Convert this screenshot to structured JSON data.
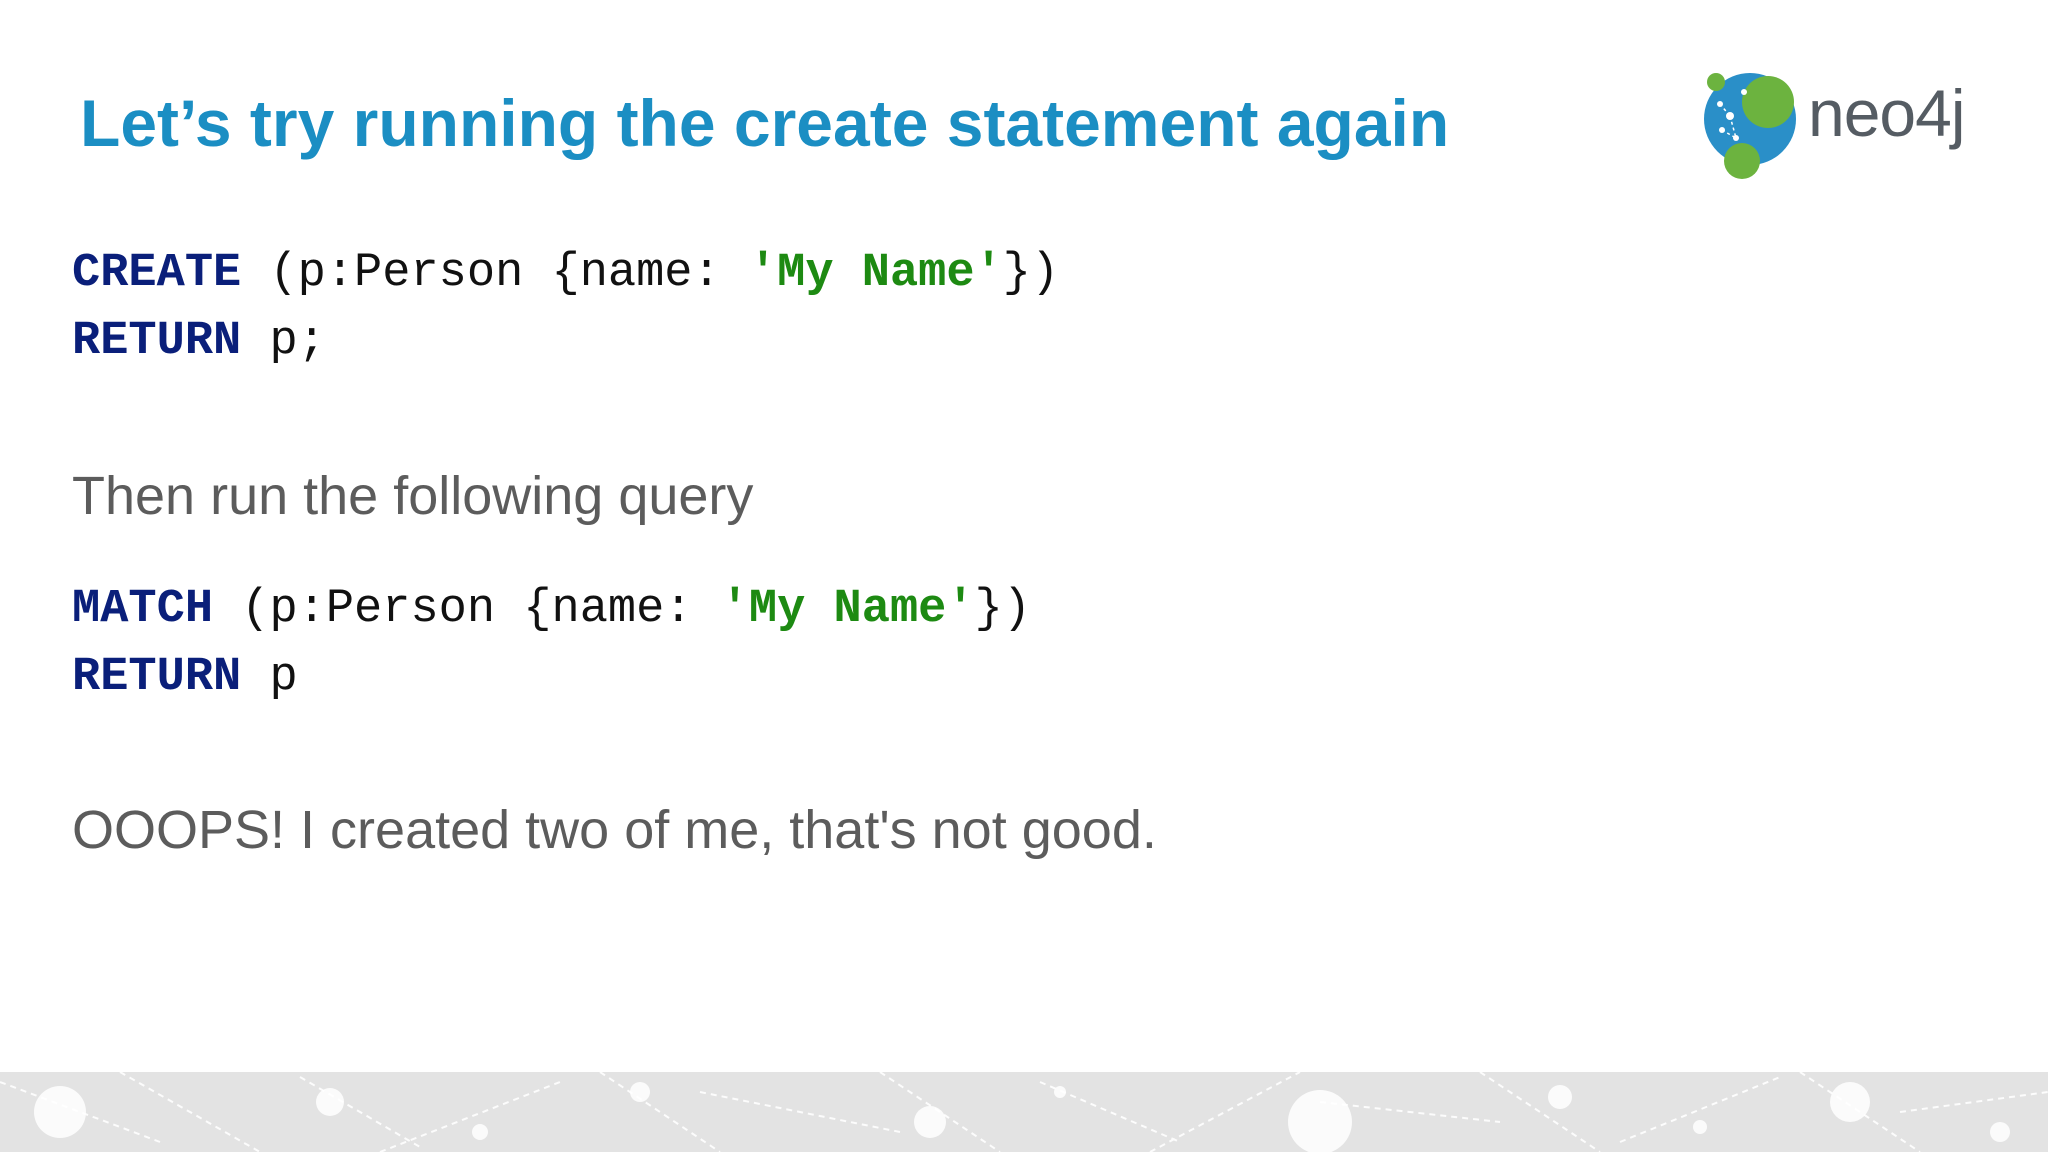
{
  "slide": {
    "title": "Let’s try running the create statement again",
    "logo_text": "neo4j",
    "colors": {
      "title": "#1b8ec3",
      "keyword": "#0a1f7a",
      "string": "#1d8a12",
      "body_text": "#5c5c5c",
      "logo_green": "#6cb33f",
      "logo_blue": "#2a8fc8"
    }
  },
  "code_block_1": {
    "line1": {
      "keyword": "CREATE",
      "pre": " (p:Person {name: ",
      "string": "'My Name'",
      "post": "})"
    },
    "line2": {
      "keyword": "RETURN",
      "rest": " p;"
    }
  },
  "instruction": "Then run the following query",
  "code_block_2": {
    "line1": {
      "keyword": "MATCH",
      "pre": " (p:Person {name: ",
      "string": "'My Name'",
      "post": "})"
    },
    "line2": {
      "keyword": "RETURN",
      "rest": " p"
    }
  },
  "conclusion": "OOOPS! I created two of me, that's not good."
}
